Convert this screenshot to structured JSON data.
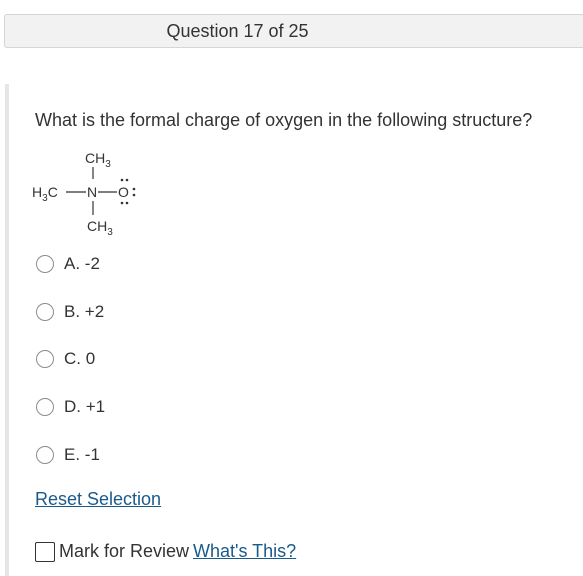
{
  "header": {
    "title": "Question 17 of 25"
  },
  "question": {
    "text": "What is the formal charge of oxygen in the following structure?"
  },
  "structure": {
    "top_group": "CH3",
    "bottom_group": "CH3",
    "left_group": "H3C",
    "center_atom": "N",
    "right_atom": "O"
  },
  "options": [
    {
      "label": "A. -2"
    },
    {
      "label": "B. +2"
    },
    {
      "label": "C. 0"
    },
    {
      "label": "D. +1"
    },
    {
      "label": "E. -1"
    }
  ],
  "actions": {
    "reset_label": "Reset Selection",
    "review_label": "Mark for Review",
    "whats_this_label": "What's This?"
  },
  "colors": {
    "link": "#1a5a8a",
    "text": "#333333",
    "header_bg": "#f2f2f2"
  }
}
